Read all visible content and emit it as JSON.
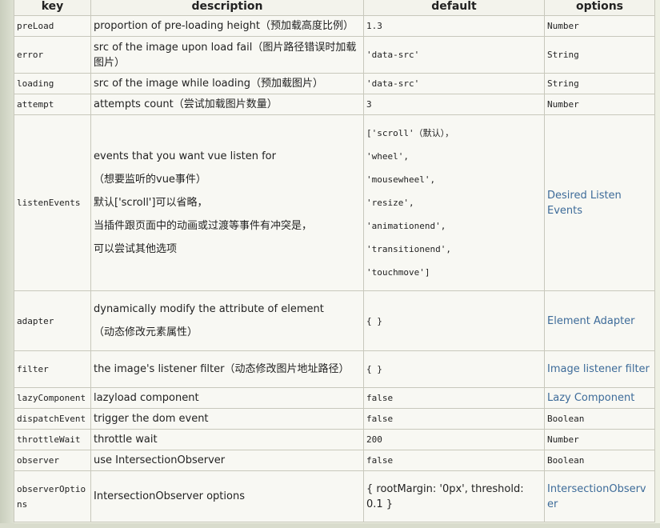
{
  "headers": {
    "key": "key",
    "description": "description",
    "default": "default",
    "options": "options"
  },
  "rows": {
    "preLoad": {
      "key": "preLoad",
      "description": "proportion of pre-loading height（预加载高度比例）",
      "default": "1.3",
      "options": "Number"
    },
    "error": {
      "key": "error",
      "description": "src of the image upon load fail（图片路径错误时加载图片）",
      "default": "'data-src'",
      "options": "String"
    },
    "loading": {
      "key": "loading",
      "description": "src of the image while loading（预加载图片）",
      "default": "'data-src'",
      "options": "String"
    },
    "attempt": {
      "key": "attempt",
      "description": "attempts count（尝试加载图片数量）",
      "default": "3",
      "options": "Number"
    },
    "listenEvents": {
      "key": "listenEvents",
      "description_lines": [
        "events that you want vue listen for",
        "（想要监听的vue事件）",
        "默认['scroll']可以省略，",
        "当插件跟页面中的动画或过渡等事件有冲突是，",
        "可以尝试其他选项"
      ],
      "default_lines": [
        "['scroll'（默认），",
        "'wheel',",
        "'mousewheel',",
        "'resize',",
        "'animationend',",
        "'transitionend',",
        "'touchmove']"
      ],
      "options": "Desired Listen Events"
    },
    "adapter": {
      "key": "adapter",
      "description_lines": [
        "dynamically modify the attribute of element",
        "（动态修改元素属性）"
      ],
      "default": "{ }",
      "options": "Element Adapter"
    },
    "filter": {
      "key": "filter",
      "description": "the image's listener filter（动态修改图片地址路径）",
      "default": "{ }",
      "options": "Image listener filter"
    },
    "lazyComponent": {
      "key": "lazyComponent",
      "description": "lazyload component",
      "default": "false",
      "options": "Lazy Component"
    },
    "dispatchEvent": {
      "key": "dispatchEvent",
      "description": "trigger the dom event",
      "default": "false",
      "options": "Boolean"
    },
    "throttleWait": {
      "key": "throttleWait",
      "description": "throttle wait",
      "default": "200",
      "options": "Number"
    },
    "observer": {
      "key": "observer",
      "description": "use IntersectionObserver",
      "default": "false",
      "options": "Boolean"
    },
    "observerOptions": {
      "key": "observerOptions",
      "description": "IntersectionObserver options",
      "default": "{ rootMargin: '0px', threshold: 0.1 }",
      "options": "IntersectionObserver"
    }
  },
  "colors": {
    "link": "#3d6b99",
    "border": "#c8c8bc",
    "cell_background": "#f8f8f3"
  }
}
